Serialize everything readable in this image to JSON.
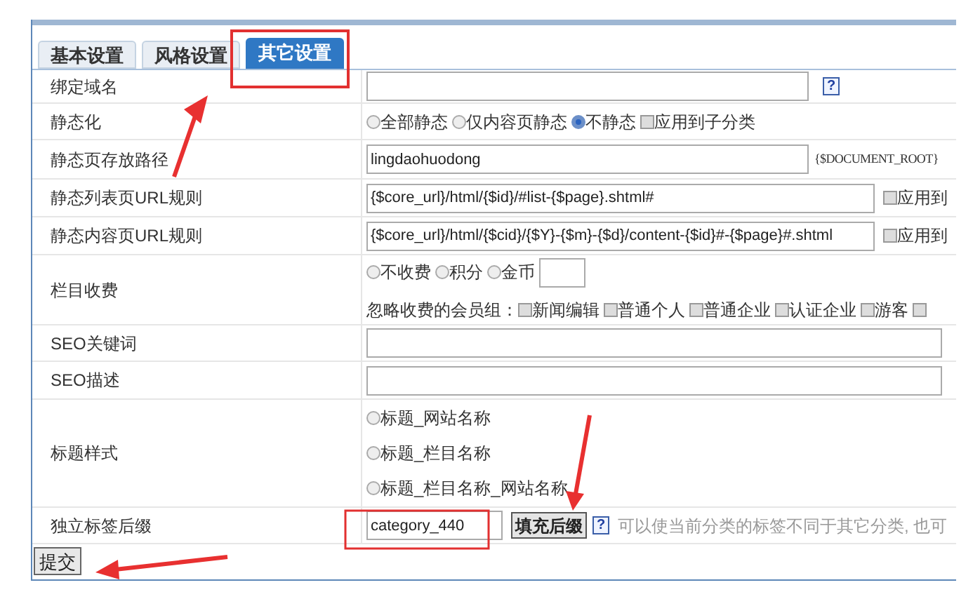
{
  "tabs": [
    {
      "label": "基本设置",
      "selected": false
    },
    {
      "label": "风格设置",
      "selected": false
    },
    {
      "label": "其它设置",
      "selected": true
    }
  ],
  "rows": [
    {
      "label": "绑定域名",
      "lines": [
        [
          {
            "kind": "input"
          },
          {
            "kind": "help",
            "text": "?"
          }
        ]
      ]
    },
    {
      "label": "静态化",
      "lines": [
        [
          {
            "kind": "radio",
            "text": "全部静态",
            "selected": false
          },
          {
            "kind": "radio",
            "text": "仅内容页静态",
            "selected": false
          },
          {
            "kind": "radio",
            "text": "不静态",
            "selected": true
          },
          {
            "kind": "checkbox",
            "text": "应用到子分类",
            "checked": false
          }
        ]
      ]
    },
    {
      "label": "静态页存放路径",
      "lines": [
        [
          {
            "kind": "input",
            "value": "lingdaohuodong"
          },
          {
            "kind": "note",
            "text": "{$DOCUMENT_ROOT}"
          }
        ]
      ]
    },
    {
      "label": "静态列表页URL规则",
      "lines": [
        [
          {
            "kind": "input",
            "value": "{$core_url}/html/{$id}/#list-{$page}.shtml#"
          },
          {
            "kind": "checkbox",
            "text": "应用到",
            "checked": false
          }
        ]
      ]
    },
    {
      "label": "静态内容页URL规则",
      "lines": [
        [
          {
            "kind": "input",
            "value": "{$core_url}/html/{$cid}/{$Y}-{$m}-{$d}/content-{$id}#-{$page}#.shtml"
          },
          {
            "kind": "checkbox",
            "text": "应用到",
            "checked": false
          }
        ]
      ]
    },
    {
      "label": "栏目收费",
      "lines": [
        [
          {
            "kind": "radio",
            "text": "不收费",
            "selected": false
          },
          {
            "kind": "radio",
            "text": "积分",
            "selected": false
          },
          {
            "kind": "radio",
            "text": "金币",
            "selected": false
          },
          {
            "kind": "input"
          }
        ],
        [
          {
            "kind": "text",
            "text": "忽略收费的会员组："
          },
          {
            "kind": "checkbox",
            "text": "新闻编辑",
            "checked": false
          },
          {
            "kind": "checkbox",
            "text": "普通个人",
            "checked": false
          },
          {
            "kind": "checkbox",
            "text": "普通企业",
            "checked": false
          },
          {
            "kind": "checkbox",
            "text": "认证企业",
            "checked": false
          },
          {
            "kind": "checkbox",
            "text": "游客",
            "checked": false
          },
          {
            "kind": "checkbox",
            "checked": false
          }
        ]
      ]
    },
    {
      "label": "SEO关键词",
      "lines": [
        [
          {
            "kind": "input"
          }
        ]
      ]
    },
    {
      "label": "SEO描述",
      "lines": [
        [
          {
            "kind": "input"
          }
        ]
      ]
    },
    {
      "label": "标题样式",
      "lines": [
        [
          {
            "kind": "radio",
            "text": "标题_网站名称",
            "selected": false
          }
        ],
        [
          {
            "kind": "radio",
            "text": "标题_栏目名称",
            "selected": false
          }
        ],
        [
          {
            "kind": "radio",
            "text": "标题_栏目名称_网站名称",
            "selected": false
          }
        ]
      ]
    },
    {
      "label": "独立标签后缀",
      "lines": [
        [
          {
            "kind": "input",
            "value": "category_440"
          },
          {
            "kind": "button",
            "text": "填充后缀"
          },
          {
            "kind": "help",
            "text": "?"
          },
          {
            "kind": "hint",
            "text": "可以使当前分类的标签不同于其它分类, 也可"
          }
        ]
      ]
    }
  ],
  "submit": "提交"
}
